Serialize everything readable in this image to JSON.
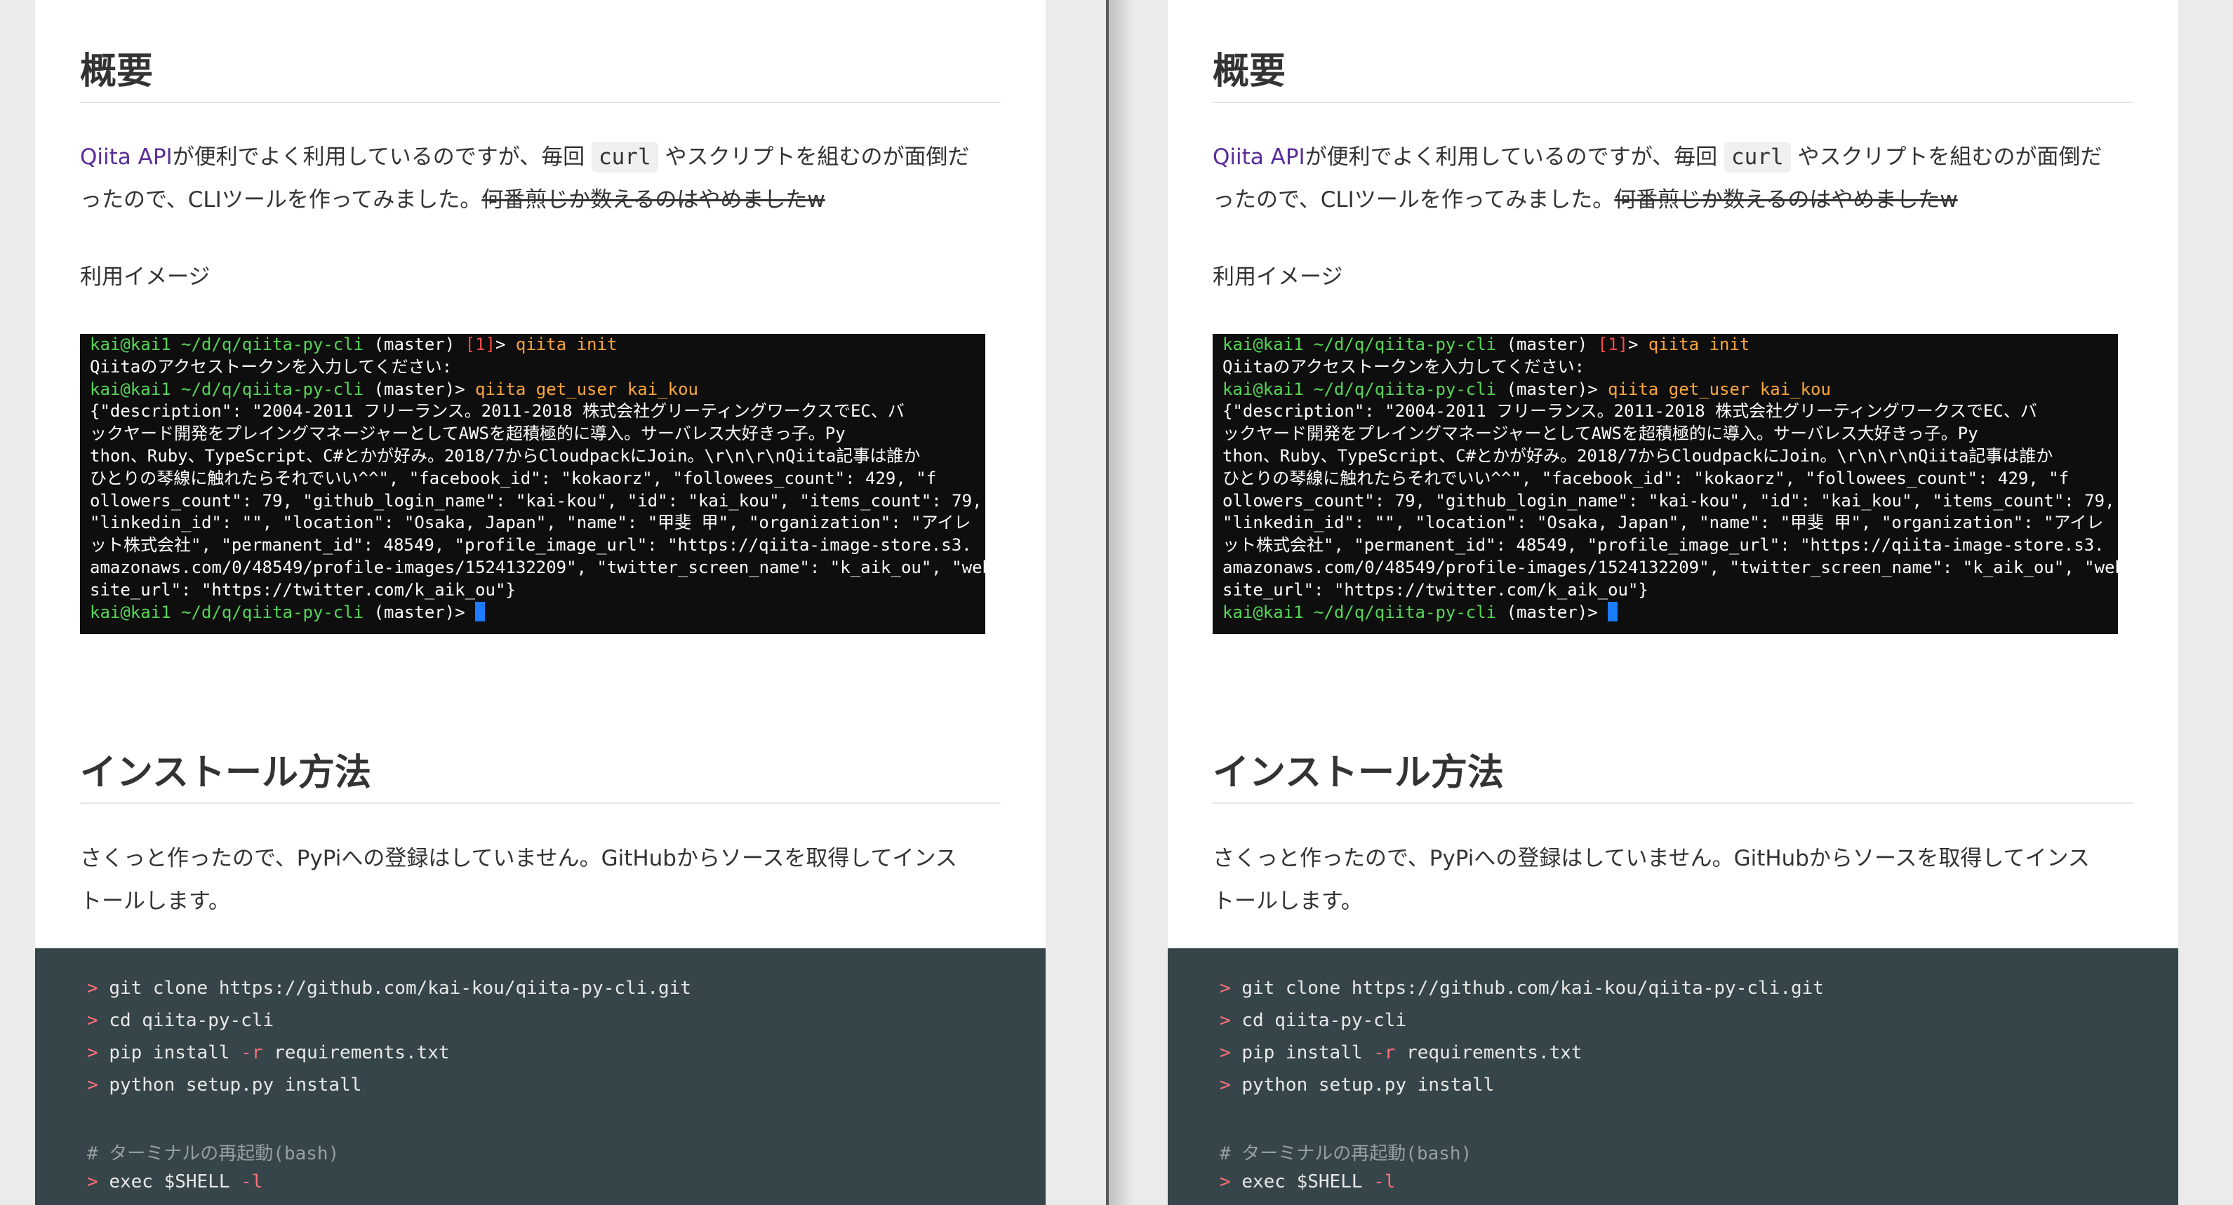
{
  "doc": {
    "heading_overview": "概要",
    "intro": {
      "link_text": "Qiita API",
      "text1": "が便利でよく利用しているのですが、毎回 ",
      "code": "curl",
      "text2": " やスクリプトを組むのが面倒だ",
      "text3": "ったので、CLIツールを作ってみました。",
      "strike": "何番煎じか数えるのはやめましたw"
    },
    "usage_label": "利用イメージ",
    "terminal": {
      "user": "kai@kai1",
      "path": "~/d/q/qiita-py-cli",
      "branch": "(master)",
      "status": "[1]",
      "prompt_sym": ">",
      "cmd1": "qiita init",
      "token_prompt": "Qiitaのアクセストークンを入力してください:",
      "cmd2": "qiita get_user kai_kou",
      "output_lines": [
        "{\"description\": \"2004-2011 フリーランス。2011-2018 株式会社グリーティングワークスでEC、バ",
        "ックヤード開発をプレイングマネージャーとしてAWSを超積極的に導入。サーバレス大好きっ子。Py",
        "thon、Ruby、TypeScript、C#とかが好み。2018/7からCloudpackにJoin。\\r\\n\\r\\nQiita記事は誰か",
        "ひとりの琴線に触れたらそれでいい^^\", \"facebook_id\": \"kokaorz\", \"followees_count\": 429, \"f",
        "ollowers_count\": 79, \"github_login_name\": \"kai-kou\", \"id\": \"kai_kou\", \"items_count\": 79,",
        "\"linkedin_id\": \"\", \"location\": \"Osaka, Japan\", \"name\": \"甲斐 甲\", \"organization\": \"アイレ",
        "ット株式会社\", \"permanent_id\": 48549, \"profile_image_url\": \"https://qiita-image-store.s3.",
        "amazonaws.com/0/48549/profile-images/1524132209\", \"twitter_screen_name\": \"k_aik_ou\", \"web",
        "site_url\": \"https://twitter.com/k_aik_ou\"}"
      ]
    },
    "heading_install": "インストール方法",
    "install_text_1": "さくっと作ったので、PyPiへの登録はしていません。GitHubからソースを取得してインス",
    "install_text_2": "トールします。",
    "code": {
      "prompt": ">",
      "line1": "git clone https://github.com/kai-kou/qiita-py-cli.git",
      "line2": "cd qiita-py-cli",
      "line3a": "pip install ",
      "line3flag": "-r",
      "line3b": " requirements.txt",
      "line4": "python setup.py install",
      "comment": "# ターミナルの再起動(bash)",
      "line5a": "exec $SHELL ",
      "line5flag": "-l"
    }
  }
}
